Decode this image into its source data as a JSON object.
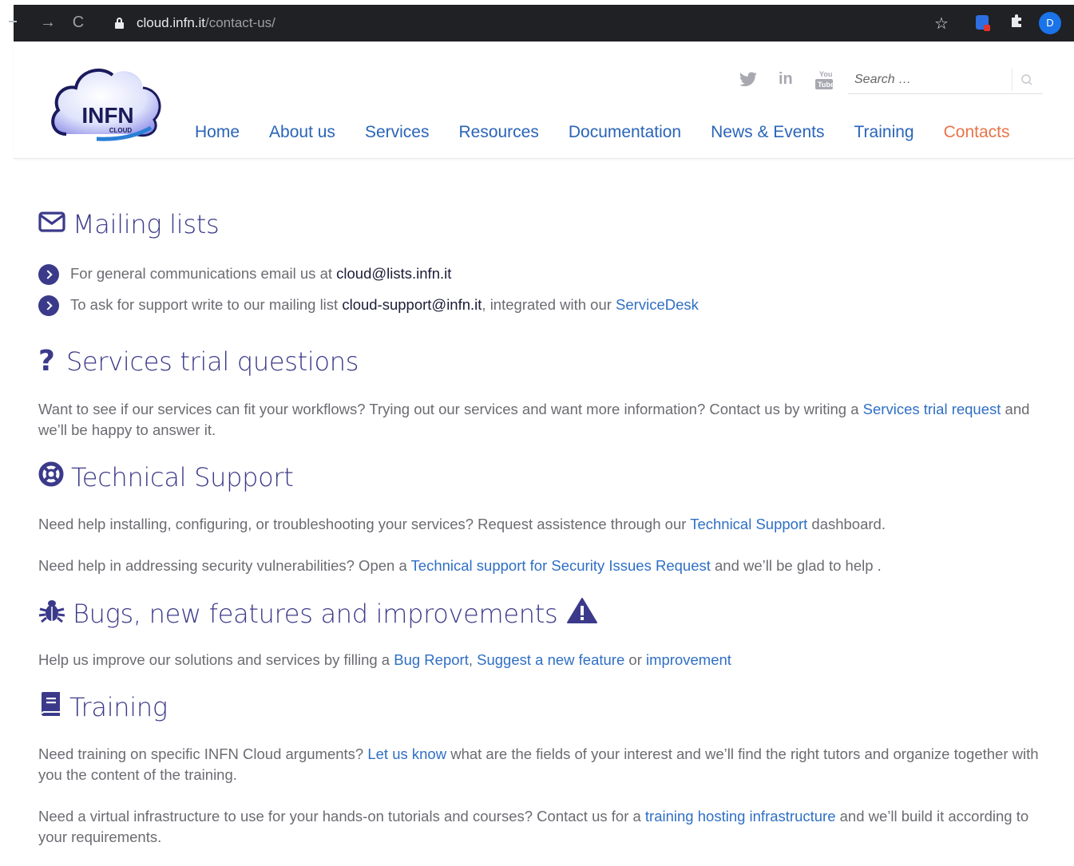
{
  "browser": {
    "url_host": "cloud.infn.it",
    "url_path": "/contact-us/",
    "profile_initial": "D"
  },
  "header": {
    "logo": {
      "main": "INFN",
      "sub": "CLOUD"
    },
    "social": [
      "twitter-icon",
      "linkedin-icon",
      "youtube-icon"
    ],
    "search_placeholder": "Search …",
    "nav": [
      {
        "label": "Home"
      },
      {
        "label": "About us"
      },
      {
        "label": "Services"
      },
      {
        "label": "Resources"
      },
      {
        "label": "Documentation"
      },
      {
        "label": "News & Events"
      },
      {
        "label": "Training"
      },
      {
        "label": "Contacts",
        "active": true
      }
    ],
    "colors": {
      "nav": "#2a64b8",
      "nav_active": "#e8744a"
    }
  },
  "sections": {
    "mailing": {
      "title": "Mailing lists",
      "item1_text": "For general communications email us at ",
      "item1_email": "cloud@lists.infn.it",
      "item2_text": "To ask for support write to our mailing list ",
      "item2_email": "cloud-support@infn.it",
      "item2_mid": ", integrated with our ",
      "item2_link": "ServiceDesk"
    },
    "trial": {
      "title": "Services trial questions",
      "p1_text": "Want to see if our services can fit your workflows? Trying out our services and want more information? Contact us by writing a ",
      "p1_link": "Services trial request",
      "p1_end": " and we’ll be happy to answer it."
    },
    "support": {
      "title": "Technical Support",
      "p1_text": "Need help installing, configuring, or troubleshooting your services? Request assistence through our ",
      "p1_link": "Technical Support",
      "p1_end": " dashboard.",
      "p2_text": "Need help in addressing security vulnerabilities? Open a ",
      "p2_link": "Technical support for Security Issues Request",
      "p2_end": " and we’ll be glad to help ."
    },
    "bugs": {
      "title": "Bugs, new features and improvements",
      "p1_text": "Help us improve our solutions and services by filling a ",
      "p1_link1": "Bug Report",
      "p1_sep": ", ",
      "p1_link2": "Suggest a new feature",
      "p1_or": " or ",
      "p1_link3": "improvement"
    },
    "training": {
      "title": "Training",
      "p1_text": "Need training on specific INFN Cloud arguments? ",
      "p1_link": "Let us know",
      "p1_end": " what are the fields of your interest and we’ll find the right tutors and organize together with you the content of the training.",
      "p2_text": "Need a virtual infrastructure to use for your hands-on tutorials and courses? Contact us for a ",
      "p2_link": "training hosting infrastructure",
      "p2_end": " and we’ll build it according to your requirements."
    }
  },
  "colors": {
    "heading": "#3b3a8a",
    "link": "#2f6fc4",
    "body_text": "#6b6b72"
  }
}
